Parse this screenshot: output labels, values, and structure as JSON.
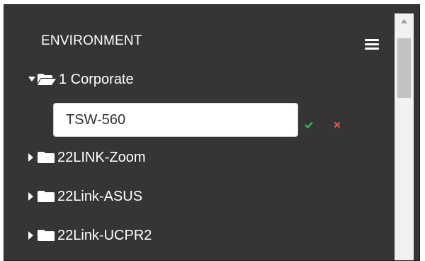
{
  "panel": {
    "title": "ENVIRONMENT",
    "menu_icon": "hamburger-menu-icon"
  },
  "tree": {
    "root": {
      "label": "1 Corporate",
      "expanded": true,
      "caret_icon": "caret-down-icon",
      "folder_icon": "folder-open-icon"
    },
    "edit": {
      "value": "TSW-560",
      "confirm_icon": "check-icon",
      "cancel_icon": "times-icon"
    },
    "items": [
      {
        "label": "22LINK-Zoom",
        "expanded": false,
        "caret_icon": "caret-right-icon",
        "folder_icon": "folder-icon"
      },
      {
        "label": "22Link-ASUS",
        "expanded": false,
        "caret_icon": "caret-right-icon",
        "folder_icon": "folder-icon"
      },
      {
        "label": "22Link-UCPR2",
        "expanded": false,
        "caret_icon": "caret-right-icon",
        "folder_icon": "folder-icon"
      }
    ]
  },
  "colors": {
    "panel_bg": "#353535",
    "text": "#ffffff",
    "confirm": "#3fb34f",
    "cancel": "#d9534f",
    "scroll_track": "#f1f1f1",
    "scroll_thumb": "#c1c1c1"
  }
}
